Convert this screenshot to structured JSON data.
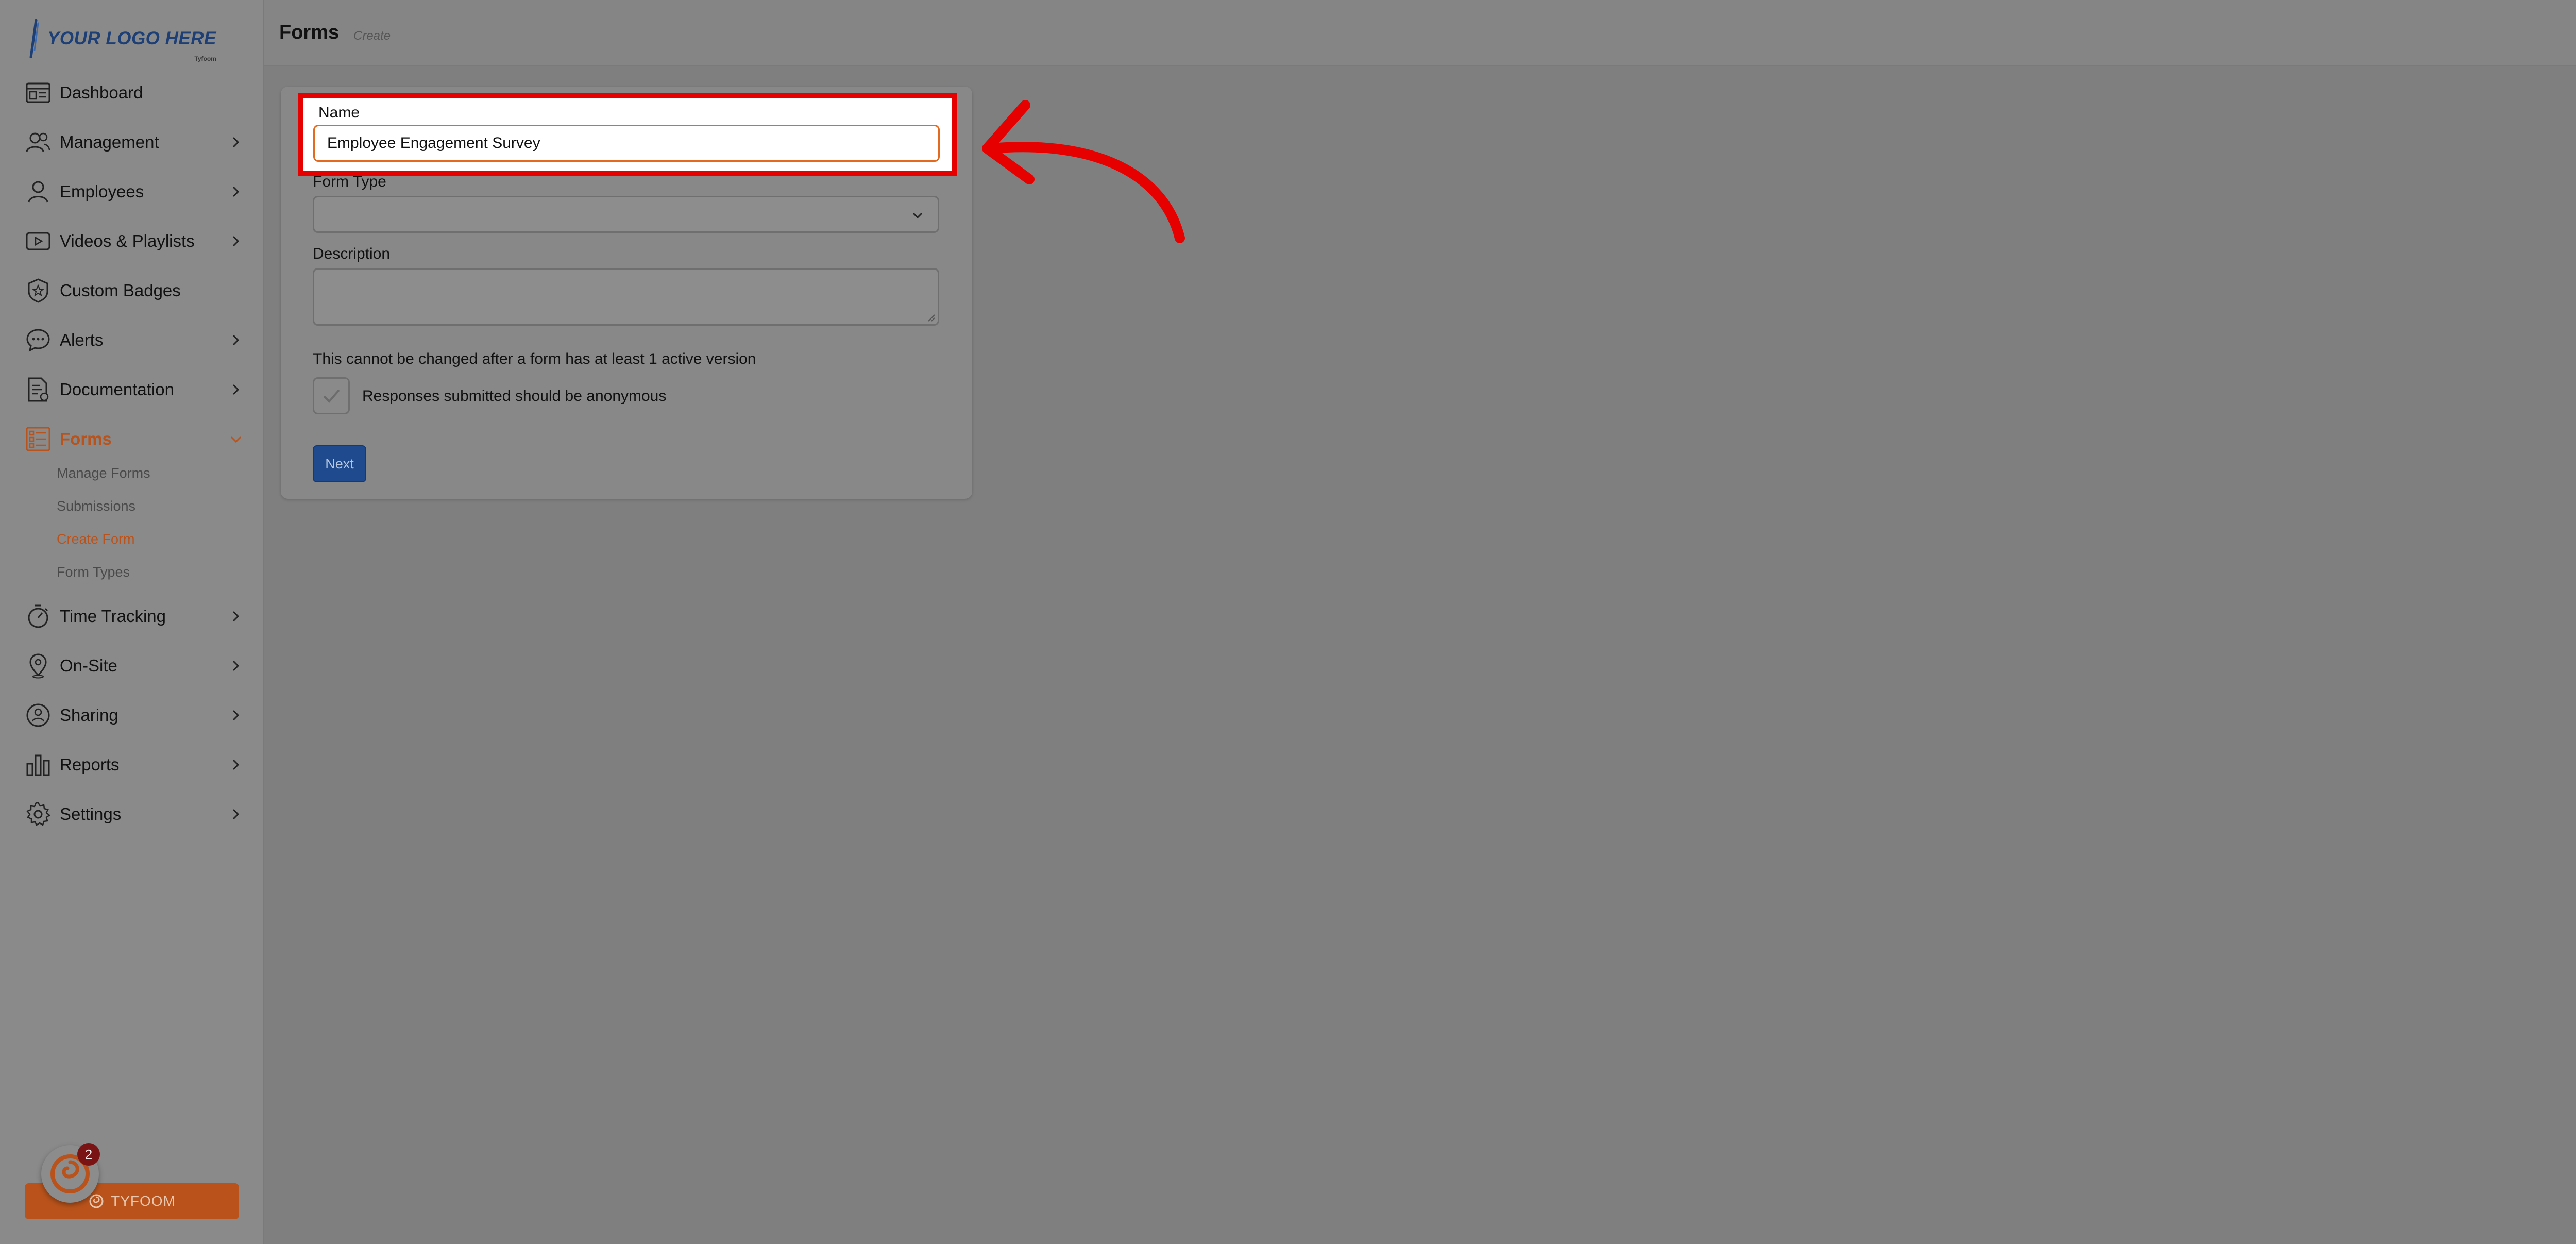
{
  "logo": {
    "text": "YOUR LOGO HERE",
    "sub": "Tyfoom"
  },
  "header": {
    "title": "Forms",
    "subtitle": "Create"
  },
  "sidebar": {
    "items": [
      {
        "label": "Dashboard",
        "icon": "dashboard-icon",
        "chevron": false
      },
      {
        "label": "Management",
        "icon": "users-icon",
        "chevron": true
      },
      {
        "label": "Employees",
        "icon": "person-icon",
        "chevron": true
      },
      {
        "label": "Videos & Playlists",
        "icon": "video-icon",
        "chevron": true
      },
      {
        "label": "Custom Badges",
        "icon": "badge-icon",
        "chevron": false
      },
      {
        "label": "Alerts",
        "icon": "chat-icon",
        "chevron": true
      },
      {
        "label": "Documentation",
        "icon": "document-icon",
        "chevron": true
      },
      {
        "label": "Forms",
        "icon": "list-icon",
        "chevron": true,
        "active": true
      },
      {
        "label": "Time Tracking",
        "icon": "stopwatch-icon",
        "chevron": true
      },
      {
        "label": "On-Site",
        "icon": "location-icon",
        "chevron": true
      },
      {
        "label": "Sharing",
        "icon": "share-icon",
        "chevron": true
      },
      {
        "label": "Reports",
        "icon": "bar-chart-icon",
        "chevron": true
      },
      {
        "label": "Settings",
        "icon": "gear-icon",
        "chevron": true
      }
    ],
    "forms_sub": [
      {
        "label": "Manage Forms"
      },
      {
        "label": "Submissions"
      },
      {
        "label": "Create Form",
        "active": true
      },
      {
        "label": "Form Types"
      }
    ],
    "tyfoom_button": "TYFOOM",
    "notification_count": "2"
  },
  "form": {
    "name_label": "Name",
    "name_value": "Employee Engagement Survey",
    "type_label": "Form Type",
    "type_value": "",
    "description_label": "Description",
    "description_value": "",
    "note": "This cannot be changed after a form has at least 1 active version",
    "anonymous_label": "Responses submitted should be anonymous",
    "anonymous_checked": true,
    "next_label": "Next"
  },
  "colors": {
    "accent": "#b9531b",
    "primary_button": "#1f4b8e",
    "annotation": "#e60000",
    "overlay_background": "#7f7f7f"
  }
}
